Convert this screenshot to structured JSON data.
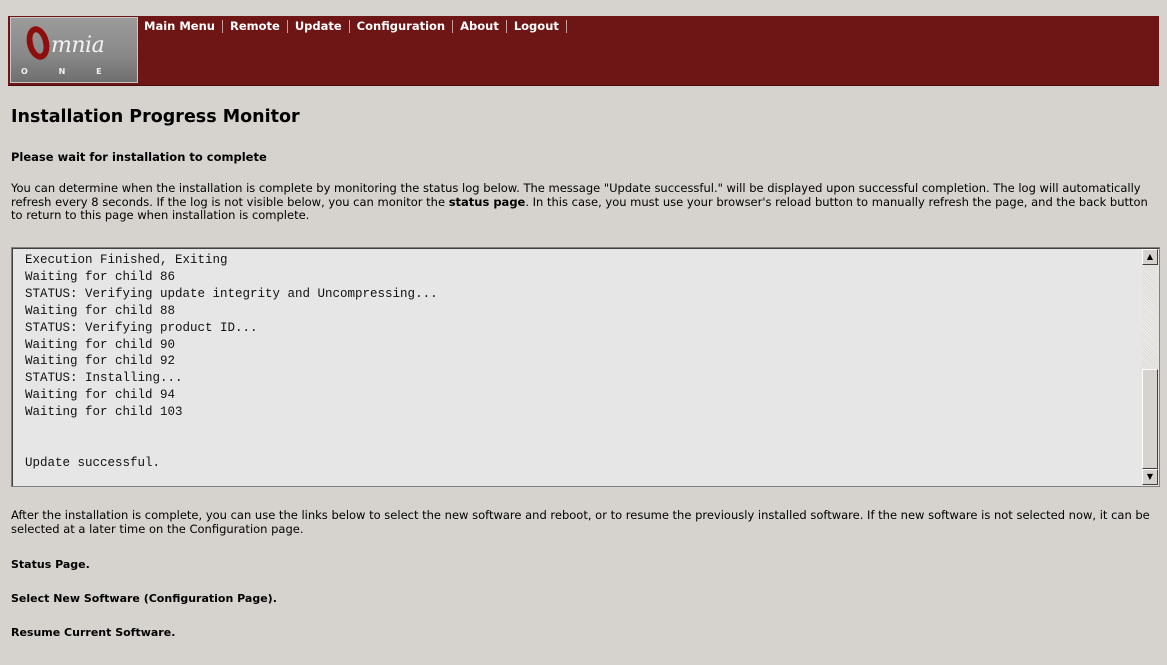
{
  "brand": {
    "logo_text": "mnia",
    "logo_tagline": "O N E"
  },
  "nav": {
    "items": [
      "Main Menu",
      "Remote",
      "Update",
      "Configuration",
      "About",
      "Logout"
    ]
  },
  "page": {
    "title": "Installation Progress Monitor",
    "subtitle": "Please wait for installation to complete",
    "intro_before": "You can determine when the installation is complete by monitoring the status log below. The message \"Update successful.\" will be displayed upon successful completion. The log will automatically refresh every 8 seconds. If the log is not visible below, you can monitor the ",
    "intro_link": "status page",
    "intro_after": ". In this case, you must use your browser's reload button to manually refresh the page, and the back button to return to this page when installation is complete.",
    "after_text": "After the installation is complete, you can use the links below to select the new software and reboot, or to resume the previously installed software. If the new software is not selected now, it can be selected at a later time on the Configuration page."
  },
  "log": {
    "lines": [
      "Execution Finished, Exiting",
      "Waiting for child 86",
      "STATUS: Verifying update integrity and Uncompressing...",
      "Waiting for child 88",
      "STATUS: Verifying product ID...",
      "Waiting for child 90",
      "Waiting for child 92",
      "STATUS: Installing...",
      "Waiting for child 94",
      "Waiting for child 103",
      "",
      "",
      "Update successful."
    ]
  },
  "links": {
    "status_page": "Status Page.",
    "select_new": "Select New Software (Configuration Page).",
    "resume": "Resume Current Software."
  },
  "colors": {
    "header_bg": "#6e1515",
    "page_bg": "#d6d3ce",
    "log_bg": "#e6e6e6"
  }
}
